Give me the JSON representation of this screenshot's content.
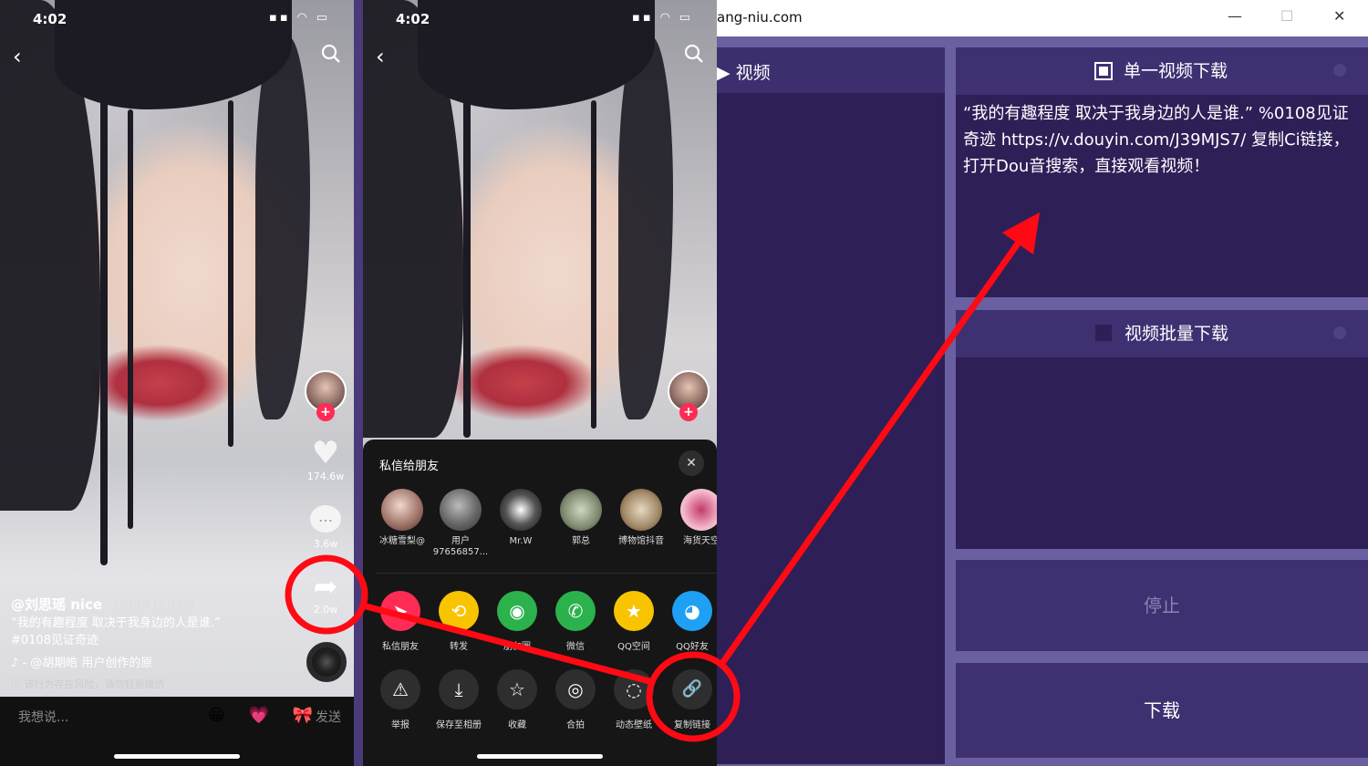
{
  "phone1": {
    "status": {
      "time": "4:02",
      "icons": "▪▪ ◠ ▭"
    },
    "side": {
      "likes": "174.6w",
      "comments": "3.6w",
      "shares": "2.0w"
    },
    "caption": {
      "user": "@刘思瑶 nice",
      "date": "· 2020年12月9日",
      "text": "“我的有趣程度 取决于我身边的人是谁.”",
      "hashtag": "#0108见证奇迹",
      "music": "♪ - @胡期皓    用户创作的原",
      "warning": "ⓘ 该行为存在风险，请勿轻易模仿"
    },
    "comment_bar": {
      "placeholder": "我想说...",
      "emojis": "😁 💗 🎀",
      "send": "发送"
    }
  },
  "phone2": {
    "status": {
      "time": "4:02"
    },
    "sheet": {
      "title": "私信给朋友",
      "close": "✕",
      "friends": [
        {
          "name": "冰糖雪梨@"
        },
        {
          "name": "用户\n97656857..."
        },
        {
          "name": "Mr.W"
        },
        {
          "name": "郭总"
        },
        {
          "name": "博物馆抖音"
        },
        {
          "name": "海货天空"
        }
      ],
      "row1": [
        {
          "label": "私信朋友",
          "icon": "➤",
          "color": "#fe2c55"
        },
        {
          "label": "转发",
          "icon": "⟲",
          "color": "#f8c400"
        },
        {
          "label": "朋友圈",
          "icon": "◉",
          "color": "#2bb24c"
        },
        {
          "label": "微信",
          "icon": "✆",
          "color": "#2bb24c"
        },
        {
          "label": "QQ空间",
          "icon": "★",
          "color": "#f8c400"
        },
        {
          "label": "QQ好友",
          "icon": "◕",
          "color": "#1ea0f5"
        }
      ],
      "row2": [
        {
          "label": "举报",
          "icon": "⚠"
        },
        {
          "label": "保存至相册",
          "icon": "⤓"
        },
        {
          "label": "收藏",
          "icon": "☆"
        },
        {
          "label": "合拍",
          "icon": "◎"
        },
        {
          "label": "动态壁纸",
          "icon": "◌"
        },
        {
          "label": "复制链接",
          "icon": "🔗"
        }
      ]
    }
  },
  "app": {
    "window_title": "ang-niu.com",
    "left_section": "▶ 视频",
    "single": {
      "title": "单一视频下载",
      "text": "“我的有趣程度 取决于我身边的人是谁.” %0108见证奇迹 https://v.douyin.com/J39MJS7/ 复制Ci链接，打开Dou音搜索，直接观看视频！"
    },
    "batch": {
      "title": "视频批量下载"
    },
    "stop_button": "停止",
    "download_button": "下载"
  },
  "colors": {
    "app_bg": "#6a5fa0",
    "panel_bg": "#2e1f57",
    "panel_head": "#3f3072",
    "annotation": "#ff0a14"
  }
}
